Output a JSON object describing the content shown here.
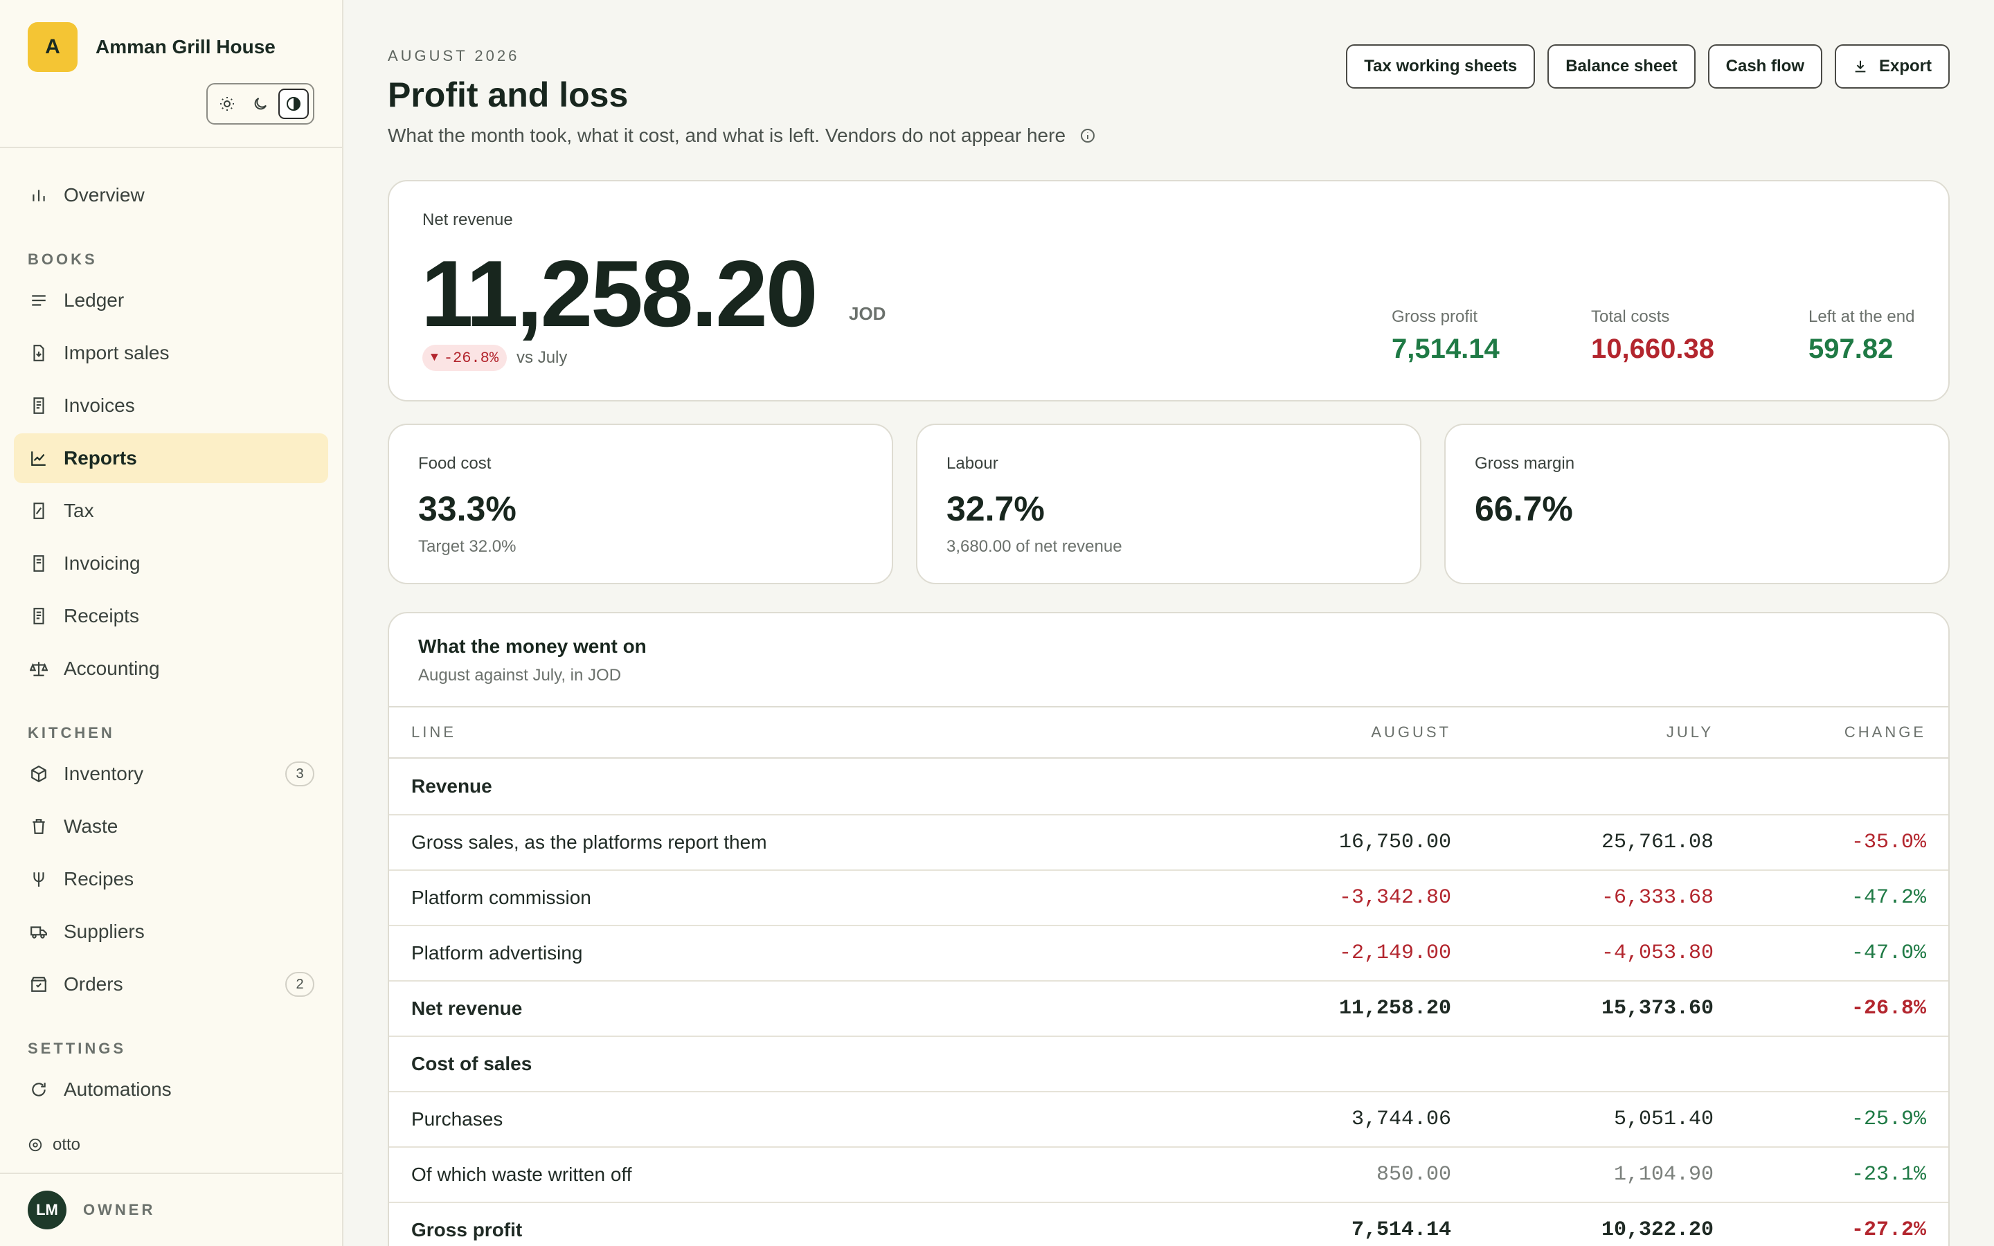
{
  "brand": {
    "initial": "A",
    "name": "Amman Grill House"
  },
  "theme_toggle": {
    "options": [
      "sun-icon",
      "moon-icon",
      "contrast-icon"
    ],
    "active": "contrast-icon"
  },
  "sidebar": {
    "overview": {
      "label": "Overview",
      "icon": "bar-chart-icon"
    },
    "sections": [
      {
        "title": "BOOKS",
        "items": [
          {
            "label": "Ledger",
            "icon": "lines-icon"
          },
          {
            "label": "Import sales",
            "icon": "file-import-icon"
          },
          {
            "label": "Invoices",
            "icon": "receipt-icon"
          },
          {
            "label": "Reports",
            "icon": "trend-icon",
            "active": true
          },
          {
            "label": "Tax",
            "icon": "tax-file-icon"
          },
          {
            "label": "Invoicing",
            "icon": "receipt-icon"
          },
          {
            "label": "Receipts",
            "icon": "receipt-icon"
          },
          {
            "label": "Accounting",
            "icon": "scale-icon"
          }
        ]
      },
      {
        "title": "KITCHEN",
        "items": [
          {
            "label": "Inventory",
            "icon": "box-icon",
            "badge": "3"
          },
          {
            "label": "Waste",
            "icon": "trash-icon"
          },
          {
            "label": "Recipes",
            "icon": "fork-icon"
          },
          {
            "label": "Suppliers",
            "icon": "truck-icon"
          },
          {
            "label": "Orders",
            "icon": "order-box-icon",
            "badge": "2"
          }
        ]
      },
      {
        "title": "SETTINGS",
        "items": [
          {
            "label": "Automations",
            "icon": "refresh-icon"
          }
        ]
      }
    ],
    "footer_brand": "otto",
    "user": {
      "initials": "LM",
      "role": "OWNER"
    }
  },
  "header": {
    "eyebrow": "AUGUST 2026",
    "title": "Profit and loss",
    "subtitle": "What the month took, what it cost, and what is left. Vendors do not appear here",
    "actions": [
      "Tax working sheets",
      "Balance sheet",
      "Cash flow",
      "Export"
    ]
  },
  "hero": {
    "label": "Net revenue",
    "value": "11,258.20",
    "unit": "JOD",
    "change": "-26.8%",
    "change_direction": "down",
    "change_suffix": "vs July",
    "metrics": [
      {
        "label": "Gross profit",
        "value": "7,514.14",
        "tone": "positive"
      },
      {
        "label": "Total costs",
        "value": "10,660.38",
        "tone": "negative"
      },
      {
        "label": "Left at the end",
        "value": "597.82",
        "tone": "positive"
      }
    ]
  },
  "kpis": [
    {
      "label": "Food cost",
      "value": "33.3%",
      "sub": "Target 32.0%"
    },
    {
      "label": "Labour",
      "value": "32.7%",
      "sub": "3,680.00 of net revenue"
    },
    {
      "label": "Gross margin",
      "value": "66.7%",
      "sub": ""
    }
  ],
  "table": {
    "title": "What the money went on",
    "subtitle": "August against July, in JOD",
    "columns": [
      "LINE",
      "AUGUST",
      "JULY",
      "CHANGE"
    ],
    "rows": [
      {
        "line": "Revenue",
        "august": "",
        "july": "",
        "change": "",
        "kind": "section"
      },
      {
        "line": "Gross sales, as the platforms report them",
        "august": "16,750.00",
        "july": "25,761.08",
        "change": "-35.0%",
        "change_tone": "negative"
      },
      {
        "line": "Platform commission",
        "august": "-3,342.80",
        "july": "-6,333.68",
        "change": "-47.2%",
        "value_tone": "negative",
        "change_tone": "positive"
      },
      {
        "line": "Platform advertising",
        "august": "-2,149.00",
        "july": "-4,053.80",
        "change": "-47.0%",
        "value_tone": "negative",
        "change_tone": "positive"
      },
      {
        "line": "Net revenue",
        "august": "11,258.20",
        "july": "15,373.60",
        "change": "-26.8%",
        "kind": "total",
        "change_tone": "negative"
      },
      {
        "line": "Cost of sales",
        "august": "",
        "july": "",
        "change": "",
        "kind": "section"
      },
      {
        "line": "Purchases",
        "august": "3,744.06",
        "july": "5,051.40",
        "change": "-25.9%",
        "change_tone": "positive"
      },
      {
        "line": "Of which waste written off",
        "august": "850.00",
        "july": "1,104.90",
        "change": "-23.1%",
        "value_tone": "muted",
        "change_tone": "positive"
      },
      {
        "line": "Gross profit",
        "august": "7,514.14",
        "july": "10,322.20",
        "change": "-27.2%",
        "kind": "total",
        "change_tone": "negative"
      }
    ]
  },
  "colors": {
    "accent": "#f4c534",
    "active_nav": "#fcefc7",
    "positive": "#1f7a45",
    "negative": "#b3262e",
    "avatar": "#1e3a2a"
  }
}
